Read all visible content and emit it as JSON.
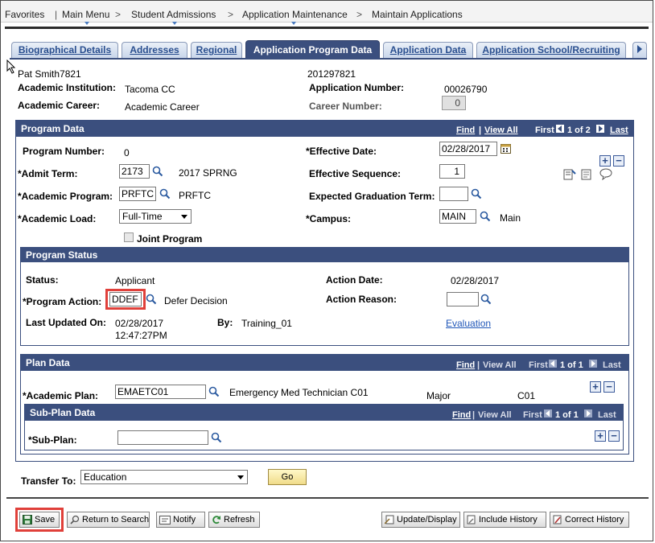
{
  "breadcrumb": {
    "items": [
      "Favorites",
      "Main Menu",
      "Student Admissions",
      "Application Maintenance",
      "Maintain Applications"
    ],
    "separator": ">"
  },
  "tabs": [
    {
      "label": "Biographical Details",
      "active": false
    },
    {
      "label": "Addresses",
      "active": false
    },
    {
      "label": "Regional",
      "active": false
    },
    {
      "label": "Application Program Data",
      "active": true
    },
    {
      "label": "Application Data",
      "active": false
    },
    {
      "label": "Application School/Recruiting",
      "active": false
    }
  ],
  "header": {
    "name": "Pat Smith7821",
    "id": "201297821",
    "institution_label": "Academic Institution:",
    "institution_value": "Tacoma CC",
    "app_number_label": "Application Number:",
    "app_number_value": "00026790",
    "career_label": "Academic Career:",
    "career_value": "Academic Career",
    "career_number_label": "Career Number:",
    "career_number_value": "0"
  },
  "program_data": {
    "title": "Program Data",
    "find": "Find",
    "view_all": "View All",
    "first": "First",
    "count": "1 of 2",
    "last": "Last",
    "program_number_label": "Program Number:",
    "program_number_value": "0",
    "effective_date_label": "*Effective Date:",
    "effective_date_value": "02/28/2017",
    "admit_term_label": "*Admit Term:",
    "admit_term_value": "2173",
    "admit_term_desc": "2017 SPRNG",
    "effective_seq_label": "Effective Sequence:",
    "effective_seq_value": "1",
    "academic_program_label": "*Academic Program:",
    "academic_program_value": "PRFTC",
    "academic_program_desc": "PRFTC",
    "exp_grad_label": "Expected Graduation Term:",
    "exp_grad_value": "",
    "academic_load_label": "*Academic Load:",
    "academic_load_value": "Full-Time",
    "campus_label": "*Campus:",
    "campus_value": "MAIN",
    "campus_desc": "Main",
    "joint_program_label": "Joint Program"
  },
  "program_status": {
    "title": "Program Status",
    "status_label": "Status:",
    "status_value": "Applicant",
    "action_date_label": "Action Date:",
    "action_date_value": "02/28/2017",
    "program_action_label": "*Program Action:",
    "program_action_value": "DDEF",
    "program_action_desc": "Defer Decision",
    "action_reason_label": "Action Reason:",
    "action_reason_value": "",
    "last_updated_label": "Last Updated On:",
    "last_updated_date": "02/28/2017",
    "last_updated_time": "12:47:27PM",
    "by_label": "By:",
    "by_value": "Training_01",
    "evaluation_link": "Evaluation"
  },
  "plan_data": {
    "title": "Plan Data",
    "find": "Find",
    "view_all": "View All",
    "first": "First",
    "count": "1 of 1",
    "last": "Last",
    "academic_plan_label": "*Academic Plan:",
    "academic_plan_value": "EMAETC01",
    "academic_plan_desc": "Emergency Med Technician C01",
    "plan_type": "Major",
    "plan_code": "C01"
  },
  "subplan_data": {
    "title": "Sub-Plan Data",
    "find": "Find",
    "view_all": "View All",
    "first": "First",
    "count": "1 of 1",
    "last": "Last",
    "sub_plan_label": "*Sub-Plan:",
    "sub_plan_value": ""
  },
  "transfer": {
    "label": "Transfer To:",
    "value": "Education",
    "go": "Go"
  },
  "toolbar": {
    "save": "Save",
    "return_to_search": "Return to Search",
    "notify": "Notify",
    "refresh": "Refresh",
    "update_display": "Update/Display",
    "include_history": "Include History",
    "correct_history": "Correct History"
  },
  "colors": {
    "section_header": "#3b4f7e",
    "highlight_box": "#e0403a",
    "link": "#1f56b8"
  }
}
